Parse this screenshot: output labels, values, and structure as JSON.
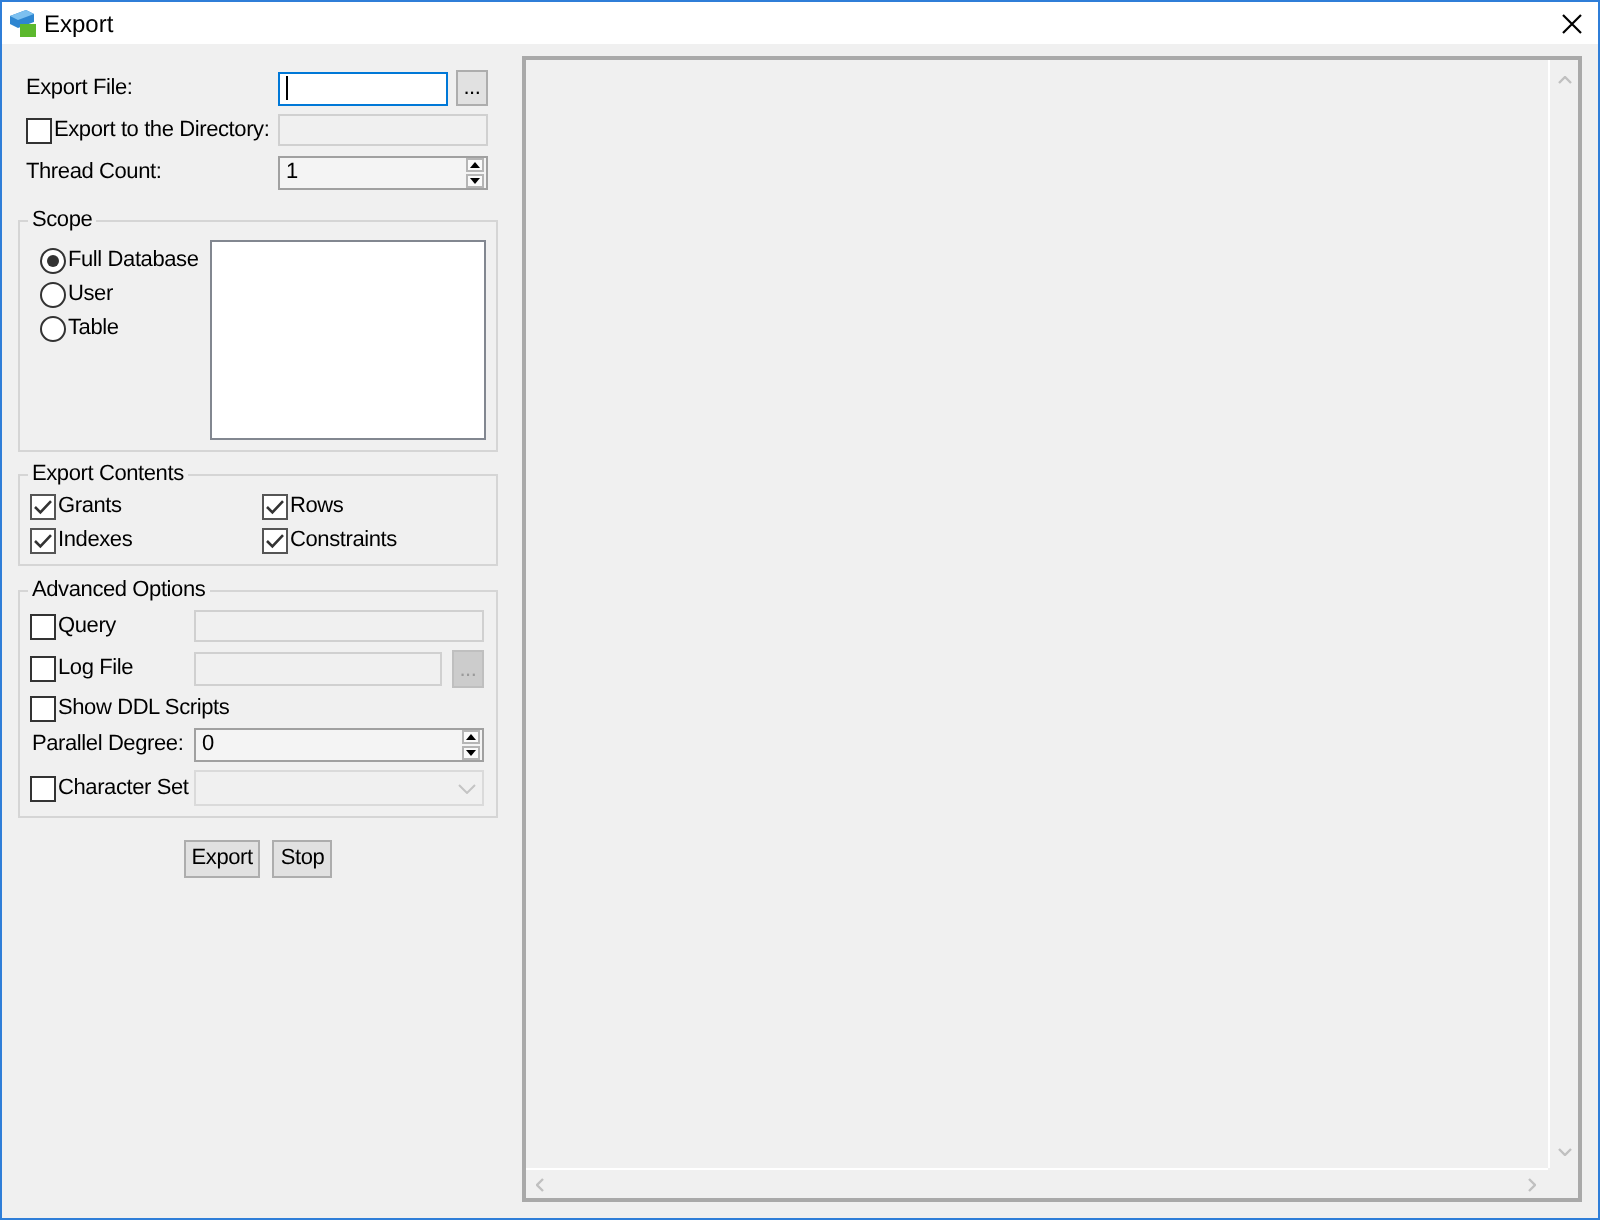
{
  "window": {
    "title": "Export"
  },
  "export_file": {
    "label": "Export File:",
    "focused": true,
    "browse_button": "..."
  },
  "export_to_directory": {
    "label": "Export to the Directory:",
    "checked": false,
    "disabled": true
  },
  "thread_count": {
    "label": "Thread Count:",
    "value": "1"
  },
  "scope": {
    "title": "Scope",
    "options": [
      {
        "label": "Full Database",
        "selected": true
      },
      {
        "label": "User",
        "selected": false
      },
      {
        "label": "Table",
        "selected": false
      }
    ]
  },
  "export_contents": {
    "title": "Export Contents",
    "items": [
      {
        "label": "Grants",
        "checked": true
      },
      {
        "label": "Rows",
        "checked": true
      },
      {
        "label": "Indexes",
        "checked": true
      },
      {
        "label": "Constraints",
        "checked": true
      }
    ]
  },
  "advanced_options": {
    "title": "Advanced Options",
    "rows": [
      {
        "kind": "text",
        "label": "Query",
        "checked": false,
        "disabled": true
      },
      {
        "kind": "file",
        "label": "Log File",
        "checked": false,
        "disabled": true,
        "browse_button": "..."
      },
      {
        "kind": "flag",
        "label": "Show DDL Scripts",
        "checked": false
      },
      {
        "kind": "spin",
        "label": "Parallel Degree:",
        "value": "0"
      },
      {
        "kind": "combo",
        "label": "Character Set",
        "checked": false,
        "disabled": true
      }
    ]
  },
  "buttons": [
    {
      "label": "Export"
    },
    {
      "label": "Stop"
    }
  ]
}
